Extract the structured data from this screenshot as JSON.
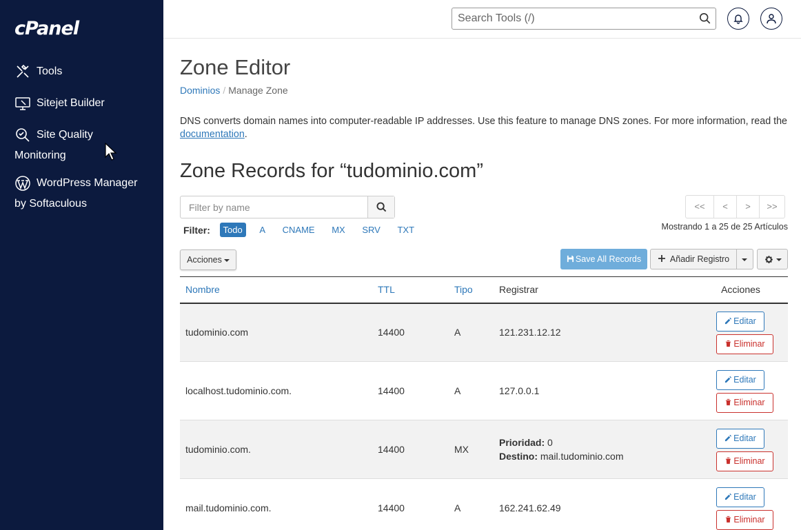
{
  "sidebar": {
    "logo": "cPanel",
    "items": [
      {
        "label": "Tools"
      },
      {
        "label": "Sitejet Builder"
      },
      {
        "label": "Site Quality",
        "label2": "Monitoring"
      },
      {
        "label": "WordPress Manager",
        "label2": "by Softaculous"
      }
    ]
  },
  "topbar": {
    "search_placeholder": "Search Tools (/)"
  },
  "page": {
    "title": "Zone Editor",
    "breadcrumb": {
      "parent": "Dominios",
      "separator": "/",
      "current": "Manage Zone"
    },
    "description_pre": "DNS converts domain names into computer-readable IP addresses. Use this feature to manage DNS zones. For more information, read the ",
    "description_link": "documentation",
    "description_post": ".",
    "zone_title": "Zone Records for “tudominio.com”"
  },
  "toolbar": {
    "filter_placeholder": "Filter by name",
    "filter_label": "Filter:",
    "filters": [
      "Todo",
      "A",
      "CNAME",
      "MX",
      "SRV",
      "TXT"
    ],
    "active_filter": "Todo",
    "pager": [
      "<<",
      "<",
      ">",
      ">>"
    ],
    "showing": "Mostrando 1 a 25 de 25 Artículos",
    "acciones_label": "Acciones",
    "save_label": "Save All Records",
    "add_label": "Añadir Registro"
  },
  "table": {
    "headers": {
      "name": "Nombre",
      "ttl": "TTL",
      "type": "Tipo",
      "record": "Registrar",
      "actions": "Acciones"
    },
    "edit_label": "Editar",
    "delete_label": "Eliminar",
    "priority_label": "Prioridad:",
    "dest_label": "Destino:",
    "rows": [
      {
        "name": "tudominio.com",
        "ttl": "14400",
        "type": "A",
        "record": "121.231.12.12"
      },
      {
        "name": "localhost.tudominio.com.",
        "ttl": "14400",
        "type": "A",
        "record": "127.0.0.1"
      },
      {
        "name": "tudominio.com.",
        "ttl": "14400",
        "type": "MX",
        "priority": "0",
        "dest": "mail.tudominio.com"
      },
      {
        "name": "mail.tudominio.com.",
        "ttl": "14400",
        "type": "A",
        "record": "162.241.62.49"
      }
    ]
  },
  "colors": {
    "sidebar_bg": "#0c1a3e",
    "link": "#2e78b9",
    "danger": "#c9302c",
    "save_btn": "#6faddb"
  }
}
